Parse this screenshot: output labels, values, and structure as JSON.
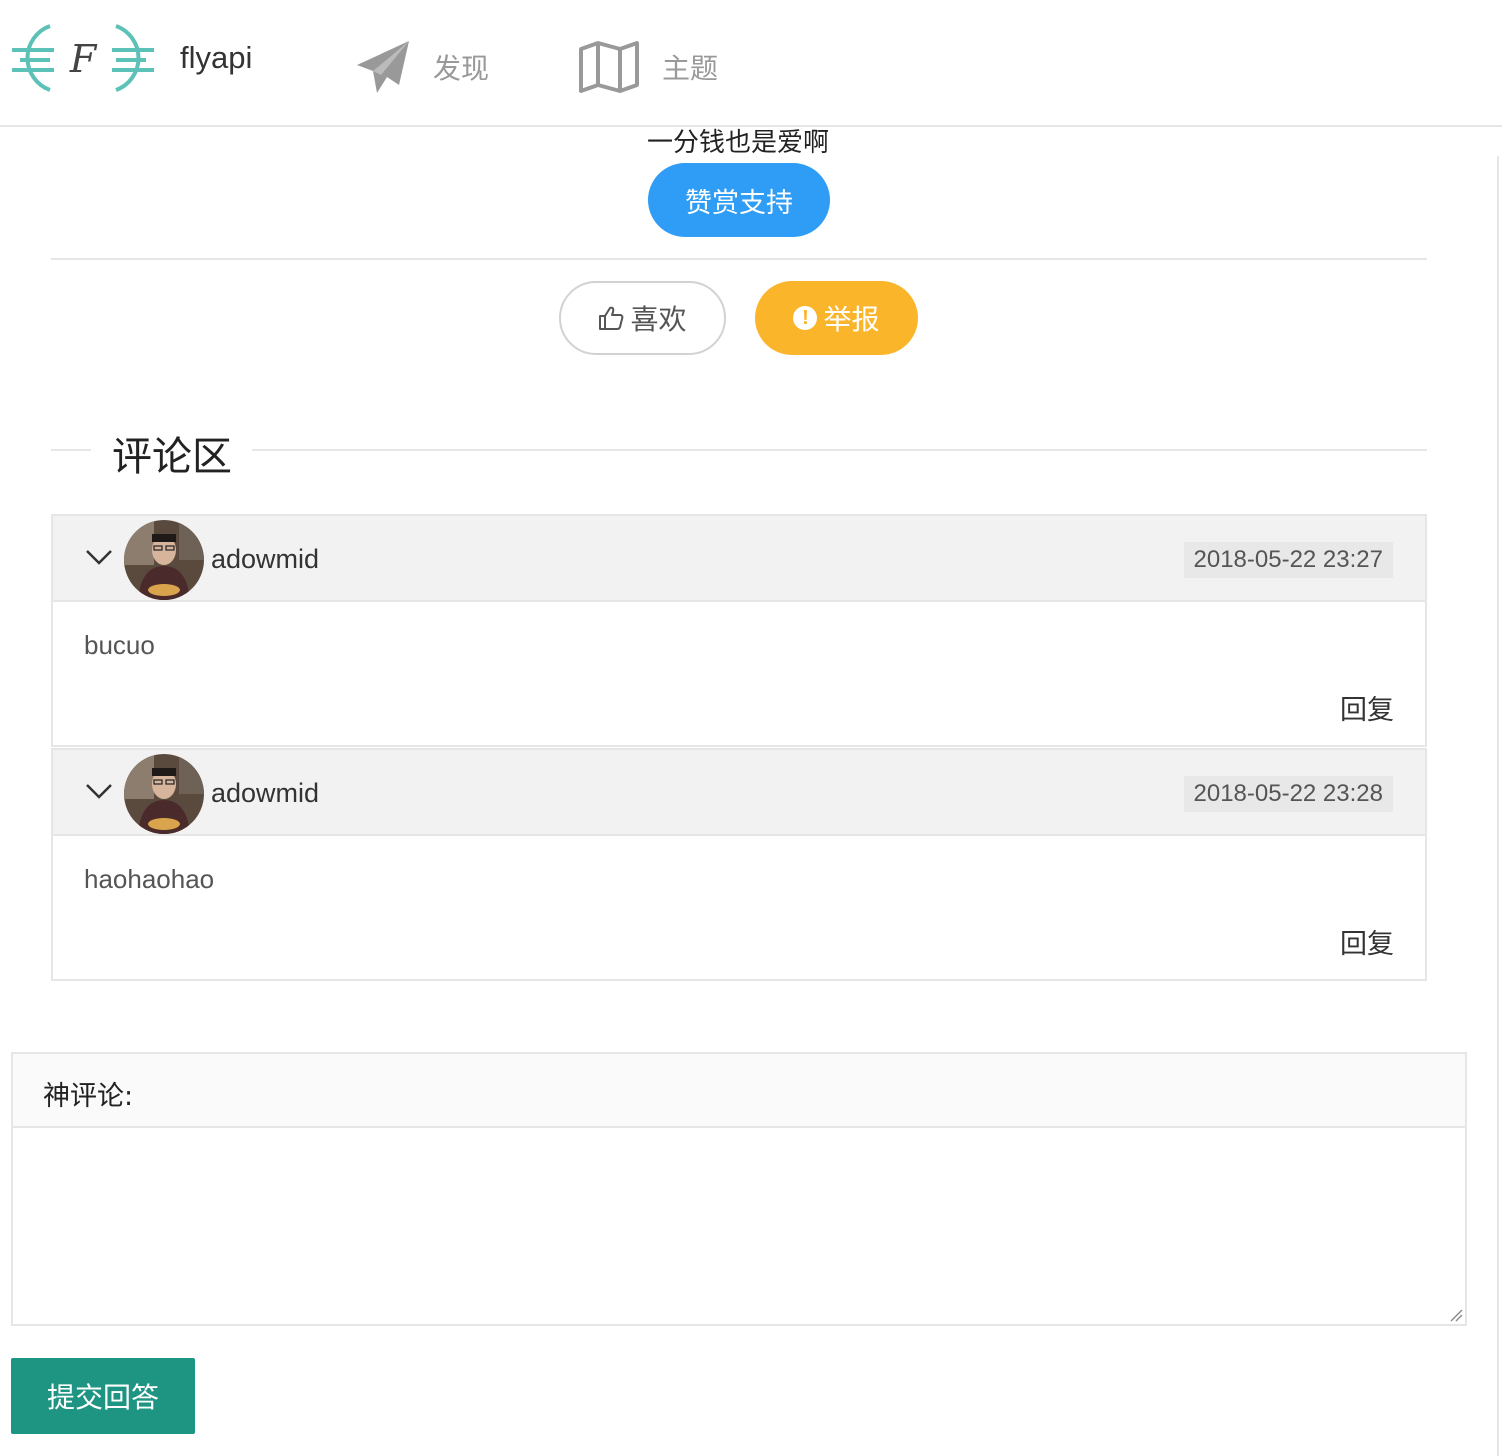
{
  "header": {
    "brand": "flyapi",
    "nav": [
      {
        "label": "发现",
        "icon": "paper-plane-icon"
      },
      {
        "label": "主题",
        "icon": "map-icon"
      }
    ]
  },
  "donate": {
    "slogan": "一分钱也是爱啊",
    "button_label": "赞赏支持"
  },
  "actions": {
    "like_label": "喜欢",
    "report_label": "举报"
  },
  "comments_section": {
    "title": "评论区",
    "items": [
      {
        "username": "adowmid",
        "time": "2018-05-22 23:27",
        "content": "bucuo",
        "reply_label": "回复"
      },
      {
        "username": "adowmid",
        "time": "2018-05-22 23:28",
        "content": "haohaohao",
        "reply_label": "回复"
      }
    ]
  },
  "editor": {
    "label": "神评论:",
    "value": "",
    "submit_label": "提交回答"
  },
  "colors": {
    "primary_blue": "#2f9cf5",
    "warning_orange": "#fbb52a",
    "submit_green": "#1e9482",
    "logo_teal": "#5cc1b6"
  }
}
